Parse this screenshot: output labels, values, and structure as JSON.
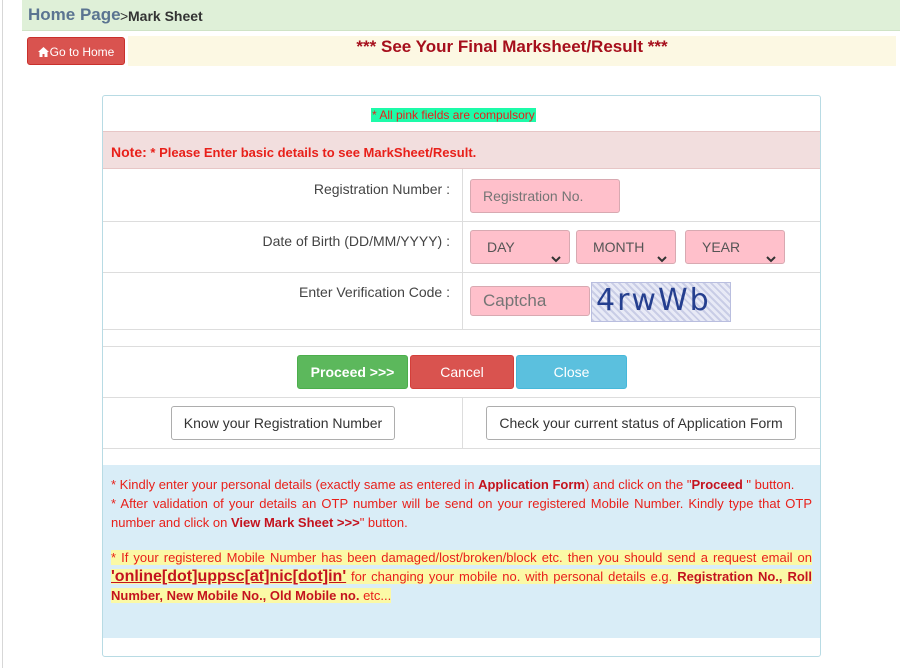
{
  "breadcrumb": {
    "home": "Home Page",
    "separator": ">",
    "current": "Mark Sheet"
  },
  "go_home_label": "Go to Home",
  "page_title": "*** See Your Final Marksheet/Result ***",
  "form": {
    "required_note": "* All pink fields are compulsory",
    "note_label": "Note:",
    "note_text": " * Please Enter basic details to see MarkSheet/Result.",
    "registration": {
      "label": "Registration Number :",
      "placeholder": "Registration No."
    },
    "dob": {
      "label": "Date of Birth (DD/MM/YYYY) :",
      "day": "DAY",
      "month": "MONTH",
      "year": "YEAR"
    },
    "verification": {
      "label": "Enter Verification Code :",
      "placeholder": "Captcha",
      "captcha_text": "4rwWb"
    },
    "buttons": {
      "proceed": "Proceed >>>",
      "cancel": "Cancel",
      "close": "Close"
    },
    "links": {
      "know_registration": "Know your Registration Number",
      "check_status": "Check your current status of Application Form"
    }
  },
  "info": {
    "p1_a": " * Kindly enter your personal details (exactly same as entered in ",
    "p1_b": "Application Form",
    "p1_c": ") and click on the \"",
    "p1_d": "Proceed",
    "p1_e": " \" button.",
    "p2_a": " * After validation of your details an OTP number will be send on your registered Mobile Number. Kindly type that OTP number and click on ",
    "p2_b": "View Mark Sheet >>>",
    "p2_c": "\" button.",
    "p3_a": " * If your registered Mobile Number has been damaged/lost/broken/block etc. then you should send a request email on ",
    "p3_email": "'online[dot]uppsc[at]nic[dot]in'",
    "p3_b": " for changing your mobile no. with personal details e.g. ",
    "p3_c": "Registration No., Roll Number, New Mobile No., Old Mobile no.",
    "p3_d": " etc..."
  },
  "colors": {
    "pink_field": "#ffc0cb",
    "danger": "#d9534f",
    "success": "#5cb85c",
    "info": "#5bc0de",
    "note_bg": "#f2dede",
    "info_bg": "#d9edf7"
  }
}
